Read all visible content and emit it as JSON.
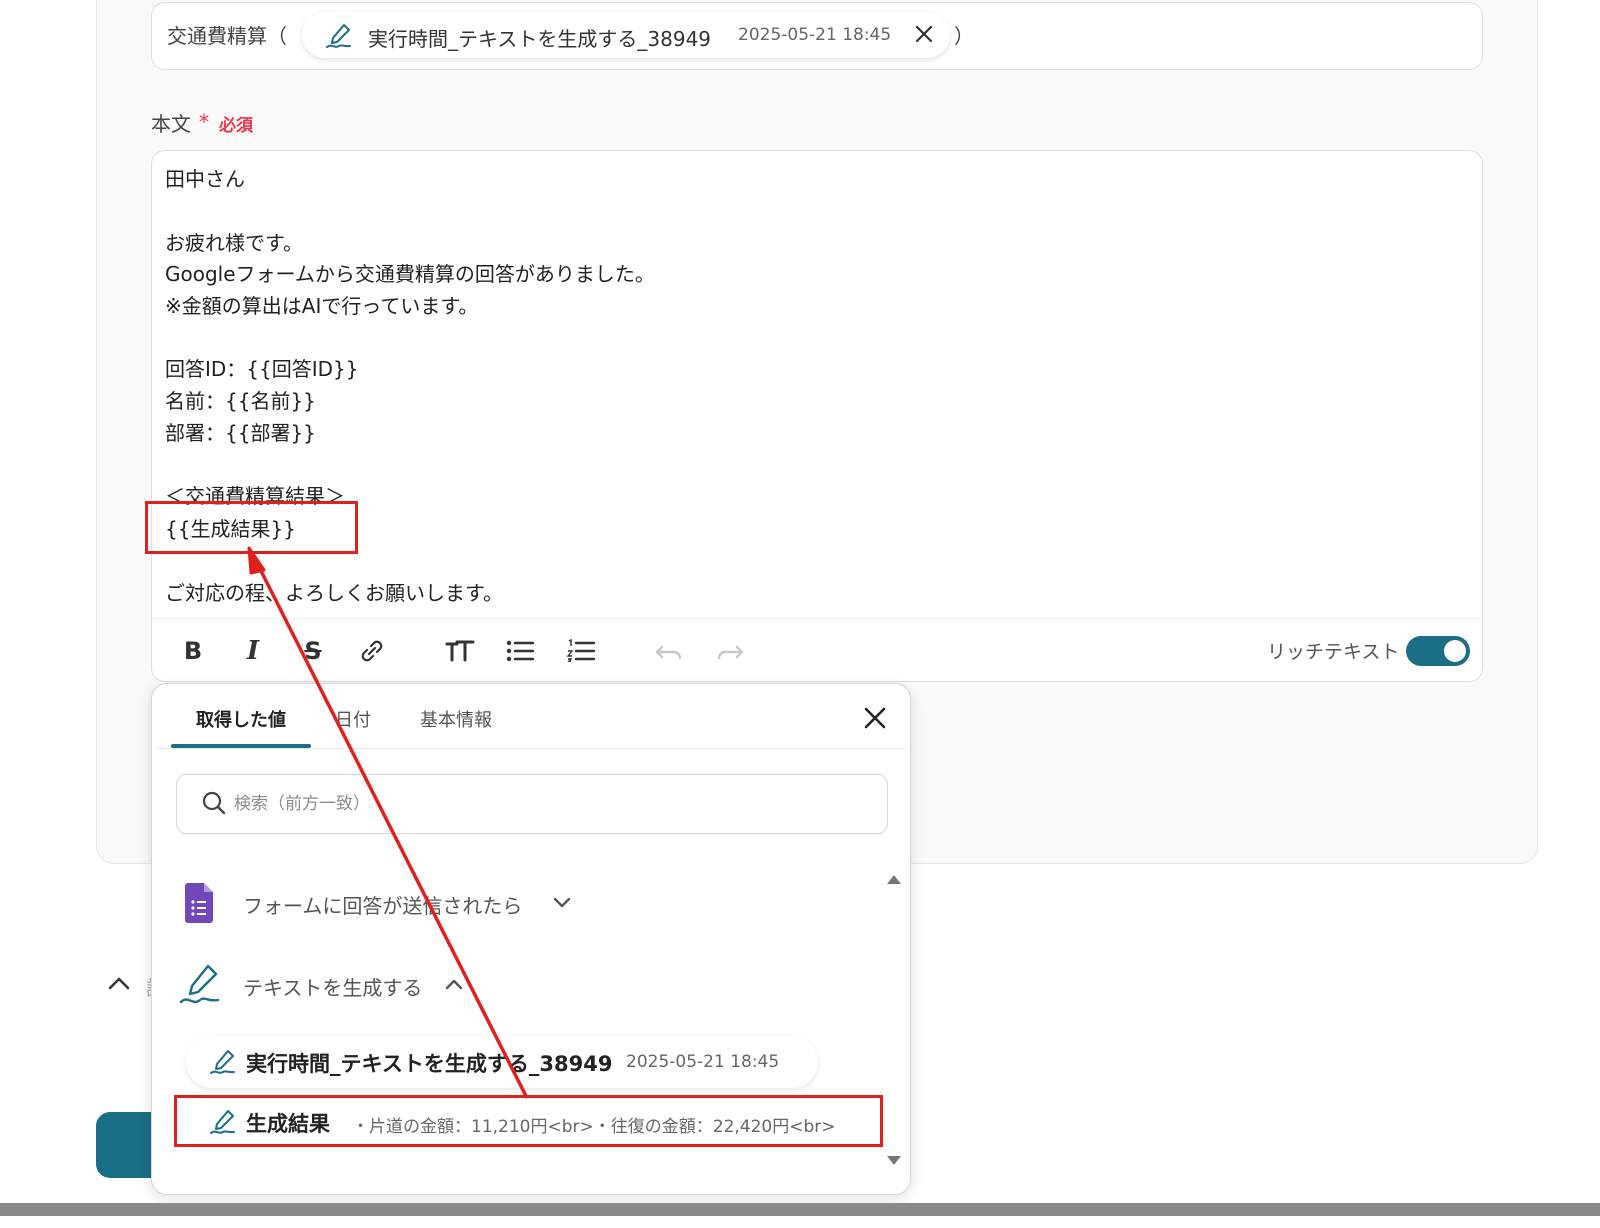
{
  "subject": {
    "prefix": "交通費精算（",
    "suffix": "）",
    "chip_label": "実行時間_テキストを生成する_38949",
    "chip_time": "2025-05-21 18:45"
  },
  "body_field": {
    "label": "本文",
    "required_star": "*",
    "required_text": "必須",
    "lines": [
      "田中さん",
      "お疲れ様です。",
      "Googleフォームから交通費精算の回答がありました。",
      "※金額の算出はAIで行っています。",
      "回答ID：{{回答ID}}",
      "名前：{{名前}}",
      "部署：{{部署}}",
      "＜交通費精算結果＞",
      "{{生成結果}}",
      "ご対応の程、よろしくお願いします。"
    ]
  },
  "toolbar": {
    "icons": [
      "bold-icon",
      "italic-icon",
      "strikethrough-icon",
      "link-icon",
      "text-size-icon",
      "bullet-list-icon",
      "numbered-list-icon",
      "undo-icon",
      "redo-icon"
    ],
    "rich_text_label": "リッチテキスト",
    "rich_text_enabled": true
  },
  "popup": {
    "tabs": [
      {
        "label": "取得した値",
        "active": true
      },
      {
        "label": "日付",
        "active": false
      },
      {
        "label": "基本情報",
        "active": false
      }
    ],
    "search_placeholder": "検索（前方一致）",
    "groups": [
      {
        "label": "フォームに回答が送信されたら",
        "icon": "google-forms-icon",
        "expanded": false
      },
      {
        "label": "テキストを生成する",
        "icon": "ai-pen-icon",
        "expanded": true
      }
    ],
    "items": [
      {
        "title": "実行時間_テキストを生成する_38949",
        "meta": "2025-05-21 18:45"
      },
      {
        "title": "生成結果",
        "meta": "・片道の金額：11,210円<br>・往復の金額：22,420円<br>"
      }
    ]
  },
  "colors": {
    "accent": "#1a6e86",
    "required": "#e8384f",
    "highlight": "#e0201c",
    "forms_purple": "#7248b9"
  }
}
